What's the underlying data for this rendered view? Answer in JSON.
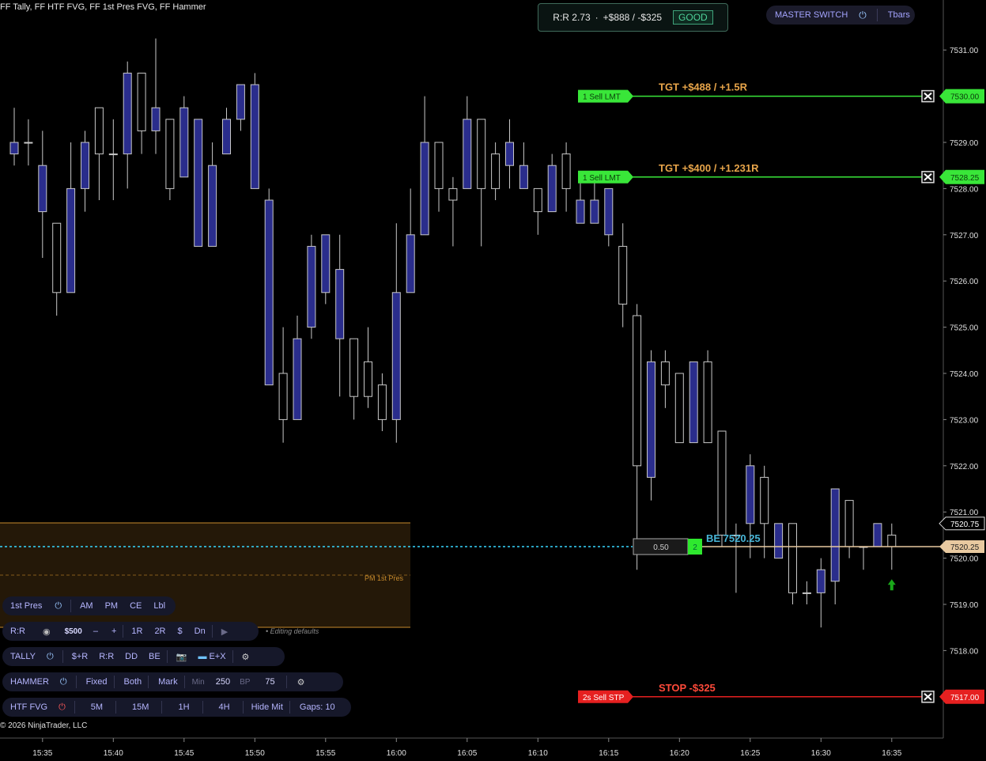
{
  "indicator_title": "FF Tally, FF HTF FVG, FF 1st Pres FVG, FF Hammer",
  "copyright": "© 2026 NinjaTrader, LLC",
  "rr_box": {
    "rr": "R:R 2.73",
    "dot": "·",
    "pnl": "+$888 / -$325",
    "status": "GOOD"
  },
  "master_switch": {
    "label": "MASTER SWITCH",
    "power_icon": "power-icon",
    "tbars": "Tbars"
  },
  "orders": {
    "tgt1": {
      "qty_label": "1  Sell LMT",
      "text": "TGT  +$488 / +1.5R",
      "price_label": "7530.00"
    },
    "tgt2": {
      "qty_label": "1  Sell LMT",
      "text": "TGT  +$400 / +1.231R",
      "price_label": "7528.25"
    },
    "stop": {
      "qty_label": "2s  Sell STP",
      "text": "STOP -$325",
      "price_label": "7517.00"
    },
    "be": {
      "box_value": "0.50",
      "qty": "2",
      "text": "BE 7520.25",
      "price_label": "7520.25"
    },
    "last_price": "7520.75"
  },
  "fvg_label": "PM 1st Pres",
  "editing_note": "• Editing defaults",
  "panels": {
    "first_pres": {
      "title": "1st Pres",
      "items": [
        "AM",
        "PM",
        "CE",
        "Lbl"
      ]
    },
    "rr": {
      "title": "R:R",
      "amount": "$500",
      "minus": "–",
      "plus": "+",
      "items": [
        "1R",
        "2R",
        "$",
        "Dn"
      ],
      "play": "▶"
    },
    "tally": {
      "title": "TALLY",
      "items": [
        "$+R",
        "R:R",
        "DD",
        "BE"
      ],
      "ex": "E+X"
    },
    "hammer": {
      "title": "HAMMER",
      "items": [
        "Fixed",
        "Both",
        "Mark"
      ],
      "min_label": "Min",
      "min_val": "250",
      "bp_label": "BP",
      "bp_val": "75"
    },
    "htf_fvg": {
      "title": "HTF FVG",
      "items": [
        "5M",
        "15M",
        "1H",
        "4H",
        "Hide Mit",
        "Gaps: 10"
      ]
    }
  },
  "colors": {
    "bear_body": "#2a2d8c",
    "bull_body": "#000000",
    "wick": "#c8c8c8",
    "target_line": "#39e639",
    "stop_line": "#e62020",
    "be_line": "#e8c9a0",
    "fvg_fill": "#241808",
    "fvg_border": "#c78a2c"
  },
  "chart_data": {
    "type": "candlestick",
    "y_axis": {
      "min": 7516.0,
      "max": 7532.0,
      "ticks": [
        "7531.00",
        "7529.00",
        "7528.00",
        "7527.00",
        "7526.00",
        "7525.00",
        "7524.00",
        "7523.00",
        "7522.00",
        "7521.00",
        "7520.00",
        "7519.00",
        "7518.00"
      ]
    },
    "x_axis": {
      "ticks": [
        "15:35",
        "15:40",
        "15:45",
        "15:50",
        "15:55",
        "16:00",
        "16:05",
        "16:10",
        "16:15",
        "16:20",
        "16:25",
        "16:30",
        "16:35"
      ]
    },
    "bar_minutes": 1,
    "first_bar_time": "15:33",
    "candles": [
      {
        "t": "15:33",
        "o": 7529.0,
        "h": 7529.75,
        "l": 7528.5,
        "c": 7528.75
      },
      {
        "t": "15:34",
        "o": 7529.0,
        "h": 7529.5,
        "l": 7528.5,
        "c": 7529.0
      },
      {
        "t": "15:35",
        "o": 7528.5,
        "h": 7529.25,
        "l": 7526.5,
        "c": 7527.5
      },
      {
        "t": "15:36",
        "o": 7525.75,
        "h": 7527.0,
        "l": 7525.25,
        "c": 7527.25
      },
      {
        "t": "15:37",
        "o": 7528.0,
        "h": 7529.0,
        "l": 7525.75,
        "c": 7525.75
      },
      {
        "t": "15:38",
        "o": 7529.0,
        "h": 7529.25,
        "l": 7527.5,
        "c": 7528.0
      },
      {
        "t": "15:39",
        "o": 7528.75,
        "h": 7529.75,
        "l": 7527.75,
        "c": 7529.75
      },
      {
        "t": "15:40",
        "o": 7528.75,
        "h": 7529.5,
        "l": 7527.75,
        "c": 7528.75
      },
      {
        "t": "15:41",
        "o": 7530.5,
        "h": 7530.75,
        "l": 7528.0,
        "c": 7528.75
      },
      {
        "t": "15:42",
        "o": 7529.25,
        "h": 7530.5,
        "l": 7528.75,
        "c": 7530.5
      },
      {
        "t": "15:43",
        "o": 7529.75,
        "h": 7531.25,
        "l": 7528.75,
        "c": 7529.25
      },
      {
        "t": "15:44",
        "o": 7528.0,
        "h": 7529.5,
        "l": 7527.75,
        "c": 7529.5
      },
      {
        "t": "15:45",
        "o": 7529.75,
        "h": 7530.0,
        "l": 7528.25,
        "c": 7528.25
      },
      {
        "t": "15:46",
        "o": 7529.5,
        "h": 7529.5,
        "l": 7526.75,
        "c": 7526.75
      },
      {
        "t": "15:47",
        "o": 7528.5,
        "h": 7529.0,
        "l": 7526.75,
        "c": 7526.75
      },
      {
        "t": "15:48",
        "o": 7529.5,
        "h": 7529.75,
        "l": 7528.75,
        "c": 7528.75
      },
      {
        "t": "15:49",
        "o": 7530.25,
        "h": 7530.25,
        "l": 7529.25,
        "c": 7529.5
      },
      {
        "t": "15:50",
        "o": 7530.25,
        "h": 7530.5,
        "l": 7528.0,
        "c": 7528.0
      },
      {
        "t": "15:51",
        "o": 7527.75,
        "h": 7528.0,
        "l": 7523.75,
        "c": 7523.75
      },
      {
        "t": "15:52",
        "o": 7523.0,
        "h": 7525.0,
        "l": 7522.5,
        "c": 7524.0
      },
      {
        "t": "15:53",
        "o": 7524.75,
        "h": 7525.25,
        "l": 7523.0,
        "c": 7523.0
      },
      {
        "t": "15:54",
        "o": 7526.75,
        "h": 7527.0,
        "l": 7524.75,
        "c": 7525.0
      },
      {
        "t": "15:55",
        "o": 7527.0,
        "h": 7527.0,
        "l": 7525.5,
        "c": 7525.75
      },
      {
        "t": "15:56",
        "o": 7526.25,
        "h": 7527.0,
        "l": 7523.5,
        "c": 7524.75
      },
      {
        "t": "15:57",
        "o": 7523.5,
        "h": 7524.75,
        "l": 7523.0,
        "c": 7524.75
      },
      {
        "t": "15:58",
        "o": 7523.5,
        "h": 7525.0,
        "l": 7523.25,
        "c": 7524.25
      },
      {
        "t": "15:59",
        "o": 7523.0,
        "h": 7524.0,
        "l": 7522.75,
        "c": 7523.75
      },
      {
        "t": "16:00",
        "o": 7525.75,
        "h": 7527.25,
        "l": 7522.5,
        "c": 7523.0
      },
      {
        "t": "16:01",
        "o": 7527.0,
        "h": 7528.0,
        "l": 7525.75,
        "c": 7525.75
      },
      {
        "t": "16:02",
        "o": 7529.0,
        "h": 7530.0,
        "l": 7527.0,
        "c": 7527.0
      },
      {
        "t": "16:03",
        "o": 7528.0,
        "h": 7528.75,
        "l": 7527.5,
        "c": 7529.0
      },
      {
        "t": "16:04",
        "o": 7527.75,
        "h": 7528.25,
        "l": 7526.75,
        "c": 7528.0
      },
      {
        "t": "16:05",
        "o": 7529.5,
        "h": 7530.0,
        "l": 7528.0,
        "c": 7528.0
      },
      {
        "t": "16:06",
        "o": 7528.0,
        "h": 7529.5,
        "l": 7526.75,
        "c": 7529.5
      },
      {
        "t": "16:07",
        "o": 7528.0,
        "h": 7529.0,
        "l": 7527.75,
        "c": 7528.75
      },
      {
        "t": "16:08",
        "o": 7529.0,
        "h": 7529.5,
        "l": 7528.0,
        "c": 7528.5
      },
      {
        "t": "16:09",
        "o": 7528.5,
        "h": 7529.0,
        "l": 7528.0,
        "c": 7528.0
      },
      {
        "t": "16:10",
        "o": 7527.5,
        "h": 7528.0,
        "l": 7527.0,
        "c": 7528.0
      },
      {
        "t": "16:11",
        "o": 7528.5,
        "h": 7528.75,
        "l": 7527.5,
        "c": 7527.5
      },
      {
        "t": "16:12",
        "o": 7528.0,
        "h": 7529.0,
        "l": 7527.5,
        "c": 7528.75
      },
      {
        "t": "16:13",
        "o": 7527.75,
        "h": 7528.25,
        "l": 7527.25,
        "c": 7527.25
      },
      {
        "t": "16:14",
        "o": 7527.75,
        "h": 7528.25,
        "l": 7527.25,
        "c": 7527.25
      },
      {
        "t": "16:15",
        "o": 7528.0,
        "h": 7528.0,
        "l": 7526.75,
        "c": 7527.0
      },
      {
        "t": "16:16",
        "o": 7525.5,
        "h": 7527.25,
        "l": 7525.0,
        "c": 7526.75
      },
      {
        "t": "16:17",
        "o": 7522.0,
        "h": 7525.5,
        "l": 7519.75,
        "c": 7525.25
      },
      {
        "t": "16:18",
        "o": 7524.25,
        "h": 7524.5,
        "l": 7521.25,
        "c": 7521.75
      },
      {
        "t": "16:19",
        "o": 7523.75,
        "h": 7524.5,
        "l": 7523.25,
        "c": 7524.25
      },
      {
        "t": "16:20",
        "o": 7522.5,
        "h": 7524.0,
        "l": 7522.5,
        "c": 7524.0
      },
      {
        "t": "16:21",
        "o": 7524.25,
        "h": 7524.25,
        "l": 7522.5,
        "c": 7522.5
      },
      {
        "t": "16:22",
        "o": 7522.5,
        "h": 7524.5,
        "l": 7522.5,
        "c": 7524.25
      },
      {
        "t": "16:23",
        "o": 7520.5,
        "h": 7522.75,
        "l": 7520.25,
        "c": 7522.75
      },
      {
        "t": "16:24",
        "o": 7520.5,
        "h": 7520.75,
        "l": 7519.25,
        "c": 7520.5
      },
      {
        "t": "16:25",
        "o": 7522.0,
        "h": 7522.25,
        "l": 7520.0,
        "c": 7520.75
      },
      {
        "t": "16:26",
        "o": 7520.75,
        "h": 7522.0,
        "l": 7520.0,
        "c": 7521.75
      },
      {
        "t": "16:27",
        "o": 7520.75,
        "h": 7520.75,
        "l": 7520.0,
        "c": 7520.0
      },
      {
        "t": "16:28",
        "o": 7519.25,
        "h": 7520.75,
        "l": 7519.0,
        "c": 7520.75
      },
      {
        "t": "16:29",
        "o": 7519.25,
        "h": 7519.5,
        "l": 7519.0,
        "c": 7519.25
      },
      {
        "t": "16:30",
        "o": 7519.75,
        "h": 7520.0,
        "l": 7518.5,
        "c": 7519.25
      },
      {
        "t": "16:31",
        "o": 7521.5,
        "h": 7521.5,
        "l": 7519.0,
        "c": 7519.5
      },
      {
        "t": "16:32",
        "o": 7520.25,
        "h": 7521.25,
        "l": 7520.0,
        "c": 7521.25
      },
      {
        "t": "16:33",
        "o": 7520.25,
        "h": 7520.25,
        "l": 7519.75,
        "c": 7520.25
      },
      {
        "t": "16:34",
        "o": 7520.75,
        "h": 7520.75,
        "l": 7520.25,
        "c": 7520.25
      },
      {
        "t": "16:35",
        "o": 7520.25,
        "h": 7520.75,
        "l": 7519.75,
        "c": 7520.5
      }
    ],
    "fvg_zone": {
      "label": "PM 1st Pres",
      "top": 7520.75,
      "bottom": 7519.25,
      "mid": 7520.0,
      "start": "15:33",
      "end": "16:00"
    },
    "levels": {
      "target1": 7530.0,
      "target2": 7528.25,
      "stop": 7517.0,
      "breakeven": 7520.25,
      "last": 7520.75
    }
  }
}
